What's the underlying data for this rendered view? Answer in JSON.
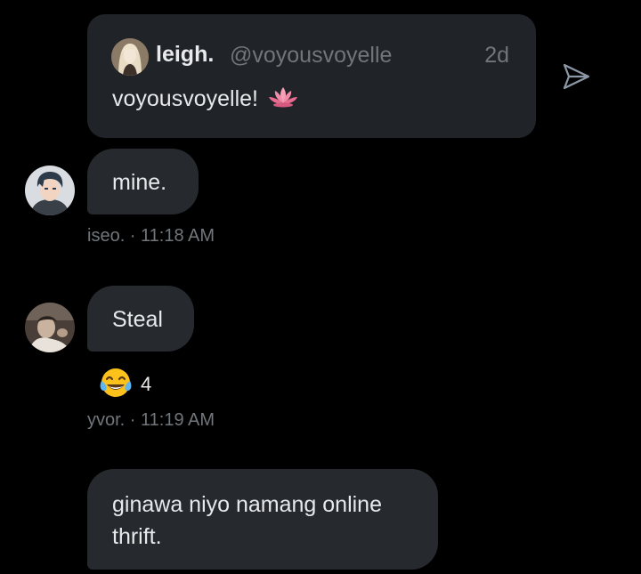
{
  "quoted_post": {
    "display_name": "leigh.",
    "handle": "@voyousvoyelle",
    "time": "2d",
    "text": "voyousvoyelle!",
    "emoji_icon": "lotus-emoji-icon"
  },
  "send_icon": "send-icon",
  "messages": [
    {
      "text": "mine.",
      "meta": "iseo. · 11:18 AM",
      "avatar_icon": "anime-boy-avatar"
    },
    {
      "text": "Steal",
      "meta": "yvor. · 11:19 AM",
      "avatar_icon": "photo-avatar",
      "reaction": {
        "emoji_icon": "tears-of-joy-emoji-icon",
        "count": "4"
      }
    },
    {
      "text": "ginawa niyo namang online thrift."
    }
  ],
  "colors": {
    "background": "#000000",
    "bubble": "#262a2f",
    "quote_card": "#202327",
    "primary_text": "#e7e9ea",
    "secondary_text": "#71767b"
  }
}
